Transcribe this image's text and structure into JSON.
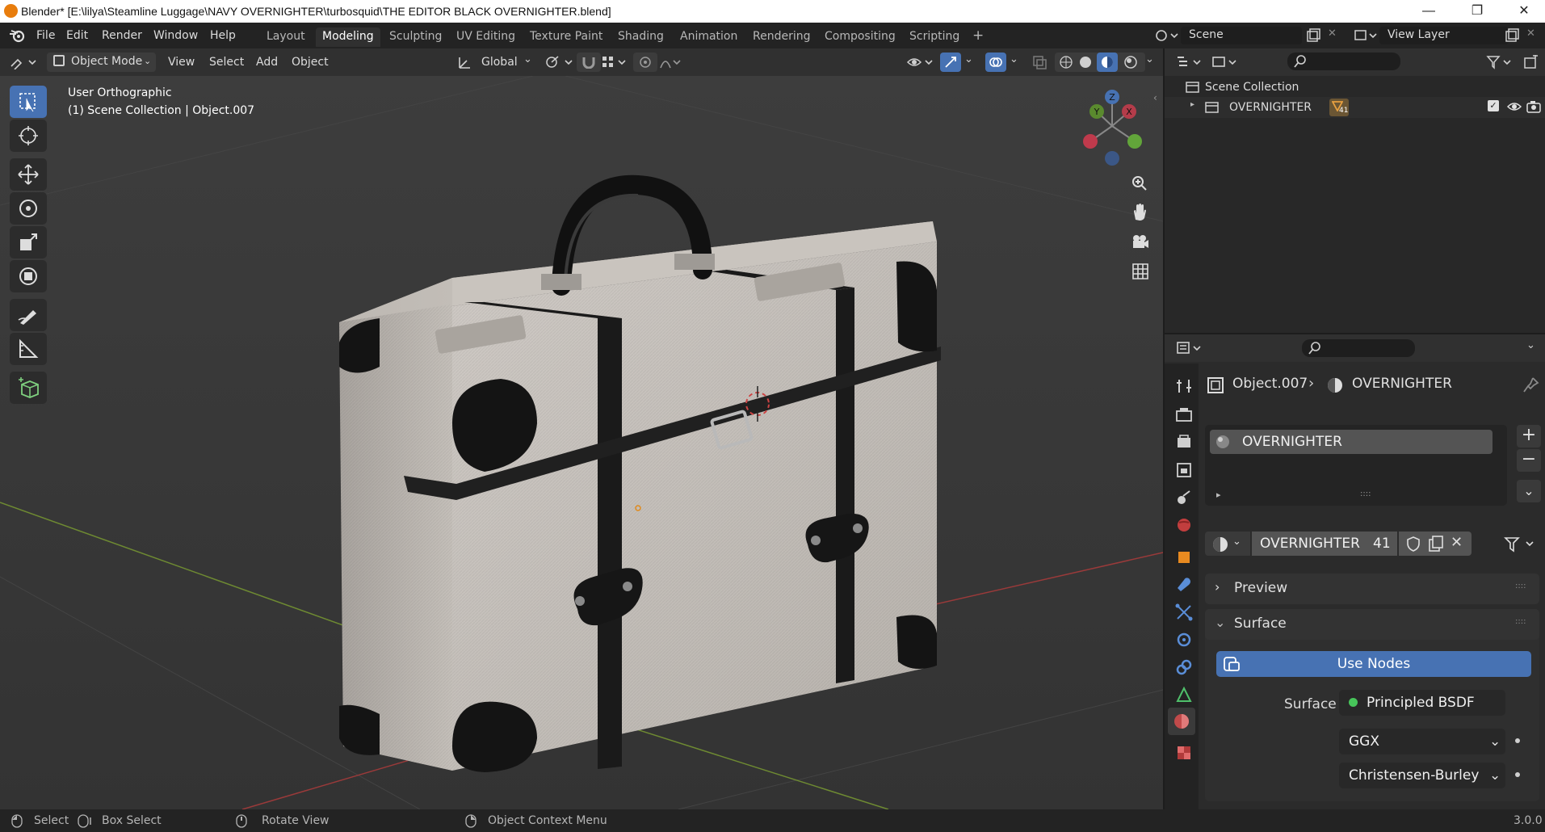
{
  "window": {
    "title": "Blender* [E:\\lilya\\Steamline Luggage\\NAVY OVERNIGHTER\\turbosquid\\THE EDITOR BLACK OVERNIGHTER.blend]",
    "minimize": "—",
    "maximize": "❐",
    "close": "✕"
  },
  "menu": {
    "items": [
      "File",
      "Edit",
      "Render",
      "Window",
      "Help"
    ]
  },
  "workspaces": {
    "tabs": [
      "Layout",
      "Modeling",
      "Sculpting",
      "UV Editing",
      "Texture Paint",
      "Shading",
      "Animation",
      "Rendering",
      "Compositing",
      "Scripting"
    ],
    "active": "Modeling",
    "add": "+"
  },
  "scene": {
    "name": "Scene",
    "view_layer": "View Layer"
  },
  "viewport_header": {
    "mode": "Object Mode",
    "menus": [
      "View",
      "Select",
      "Add",
      "Object"
    ],
    "orientation": "Global"
  },
  "viewport": {
    "view_name": "User Orthographic",
    "collection_info": "(1) Scene Collection | Object.007",
    "gizmo": {
      "z": "Z",
      "y": "Y",
      "x": "X"
    },
    "bg_color": "#393939"
  },
  "outliner": {
    "root": "Scene Collection",
    "items": [
      {
        "name": "OVERNIGHTER",
        "badge": "41"
      }
    ]
  },
  "properties": {
    "object_name": "Object.007",
    "material_context": "OVERNIGHTER",
    "slot_name": "OVERNIGHTER",
    "material_name": "OVERNIGHTER",
    "user_count": "41",
    "panels": {
      "preview": "Preview",
      "surface": "Surface"
    },
    "use_nodes_label": "Use Nodes",
    "surface_label": "Surface",
    "surface_shader": "Principled BSDF",
    "distribution": "GGX",
    "subsurface_method": "Christensen-Burley",
    "accent": "#4772b3"
  },
  "statusbar": {
    "select": "Select",
    "box_select": "Box Select",
    "rotate_view": "Rotate View",
    "context_menu": "Object Context Menu",
    "version": "3.0.0"
  }
}
